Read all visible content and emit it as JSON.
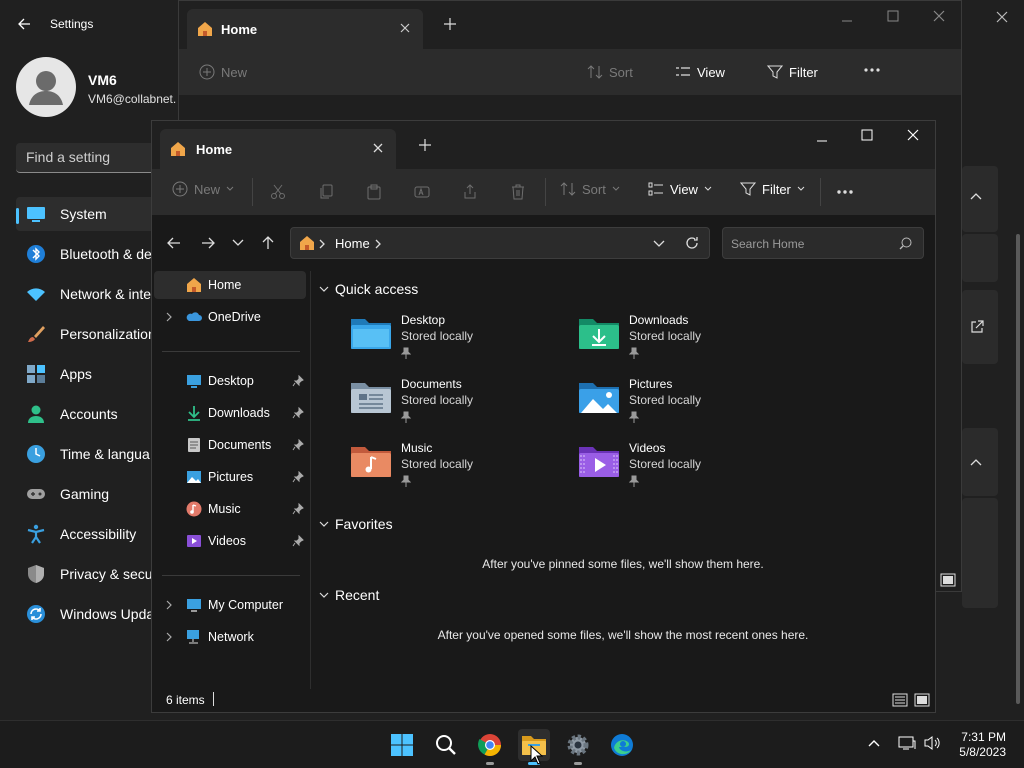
{
  "settings": {
    "title": "Settings",
    "user": {
      "name": "VM6",
      "email": "VM6@collabnet."
    },
    "search_placeholder": "Find a setting",
    "nav": [
      {
        "label": "System",
        "icon": "system-icon",
        "selected": true
      },
      {
        "label": "Bluetooth & de",
        "icon": "bluetooth-icon"
      },
      {
        "label": "Network & inte",
        "icon": "network-icon"
      },
      {
        "label": "Personalization",
        "icon": "personalization-icon"
      },
      {
        "label": "Apps",
        "icon": "apps-icon"
      },
      {
        "label": "Accounts",
        "icon": "accounts-icon"
      },
      {
        "label": "Time & langua",
        "icon": "time-language-icon"
      },
      {
        "label": "Gaming",
        "icon": "gaming-icon"
      },
      {
        "label": "Accessibility",
        "icon": "accessibility-icon"
      },
      {
        "label": "Privacy & secu",
        "icon": "privacy-icon"
      },
      {
        "label": "Windows Upda",
        "icon": "windows-update-icon"
      }
    ]
  },
  "explorer_back": {
    "tab_title": "Home",
    "toolbar": {
      "new": "New",
      "sort": "Sort",
      "view": "View",
      "filter": "Filter"
    },
    "address": "Home"
  },
  "explorer": {
    "tab_title": "Home",
    "toolbar": {
      "new": "New",
      "sort": "Sort",
      "view": "View",
      "filter": "Filter"
    },
    "address": "Home",
    "search_placeholder": "Search Home",
    "sidebar": {
      "home": "Home",
      "onedrive": "OneDrive",
      "pinned": [
        "Desktop",
        "Downloads",
        "Documents",
        "Pictures",
        "Music",
        "Videos"
      ],
      "my_computer": "My Computer",
      "network": "Network"
    },
    "quick_access": {
      "title": "Quick access",
      "items": [
        {
          "name": "Desktop",
          "status": "Stored locally",
          "icon": "desktop-folder-icon"
        },
        {
          "name": "Downloads",
          "status": "Stored locally",
          "icon": "downloads-folder-icon"
        },
        {
          "name": "Documents",
          "status": "Stored locally",
          "icon": "documents-folder-icon"
        },
        {
          "name": "Pictures",
          "status": "Stored locally",
          "icon": "pictures-folder-icon"
        },
        {
          "name": "Music",
          "status": "Stored locally",
          "icon": "music-folder-icon"
        },
        {
          "name": "Videos",
          "status": "Stored locally",
          "icon": "videos-folder-icon"
        }
      ]
    },
    "favorites": {
      "title": "Favorites",
      "empty": "After you've pinned some files, we'll show them here."
    },
    "recent": {
      "title": "Recent",
      "empty": "After you've opened some files, we'll show the most recent ones here."
    },
    "status": "6 items"
  },
  "taskbar": {
    "apps": [
      "start-icon",
      "search-icon",
      "chrome-icon",
      "file-explorer-icon",
      "settings-icon",
      "edge-icon"
    ],
    "time": "7:31 PM",
    "date": "5/8/2023"
  },
  "colors": {
    "accent": "#4cc2ff",
    "folder_yellow": "#f4c04a"
  }
}
